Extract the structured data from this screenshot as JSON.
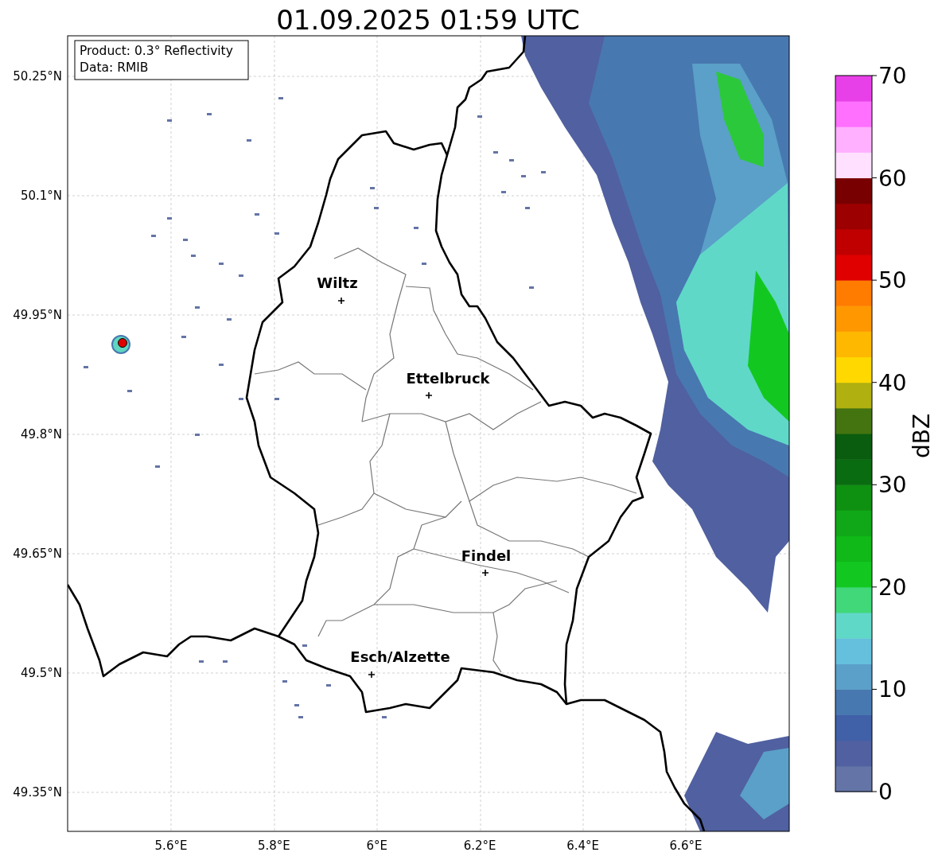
{
  "title": "01.09.2025 01:59 UTC",
  "info_box": {
    "lines": [
      "Product: 0.3° Reflectivity",
      "Data: RMIB"
    ]
  },
  "map": {
    "lat_labels": [
      "50.25°N",
      "50.1°N",
      "49.95°N",
      "49.8°N",
      "49.65°N",
      "49.5°N",
      "49.35°N"
    ],
    "lon_labels": [
      "5.6°E",
      "5.8°E",
      "6°E",
      "6.2°E",
      "6.4°E",
      "6.6°E"
    ],
    "cities": [
      {
        "name": "Wiltz"
      },
      {
        "name": "Ettelbruck"
      },
      {
        "name": "Findel"
      },
      {
        "name": "Esch/Alzette"
      }
    ]
  },
  "colorbar": {
    "label": "dBZ",
    "ticks": [
      "70",
      "60",
      "50",
      "40",
      "30",
      "20",
      "10",
      "0"
    ],
    "segments": [
      {
        "color": "#6474a6"
      },
      {
        "color": "#5060a0"
      },
      {
        "color": "#4060a8"
      },
      {
        "color": "#4878b0"
      },
      {
        "color": "#5aa0c8"
      },
      {
        "color": "#64c0dc"
      },
      {
        "color": "#60d8c8"
      },
      {
        "color": "#40d878"
      },
      {
        "color": "#12c820"
      },
      {
        "color": "#10b818"
      },
      {
        "color": "#10a818"
      },
      {
        "color": "#0e9010"
      },
      {
        "color": "#0a6c10"
      },
      {
        "color": "#0a5c0e"
      },
      {
        "color": "#447410"
      },
      {
        "color": "#b0b010"
      },
      {
        "color": "#ffd800"
      },
      {
        "color": "#ffb800"
      },
      {
        "color": "#ff9800"
      },
      {
        "color": "#ff7c00"
      },
      {
        "color": "#e00000"
      },
      {
        "color": "#c00000"
      },
      {
        "color": "#9c0000"
      },
      {
        "color": "#780000"
      },
      {
        "color": "#ffe0ff"
      },
      {
        "color": "#ffb0ff"
      },
      {
        "color": "#ff70ff"
      },
      {
        "color": "#e840e8"
      }
    ]
  }
}
